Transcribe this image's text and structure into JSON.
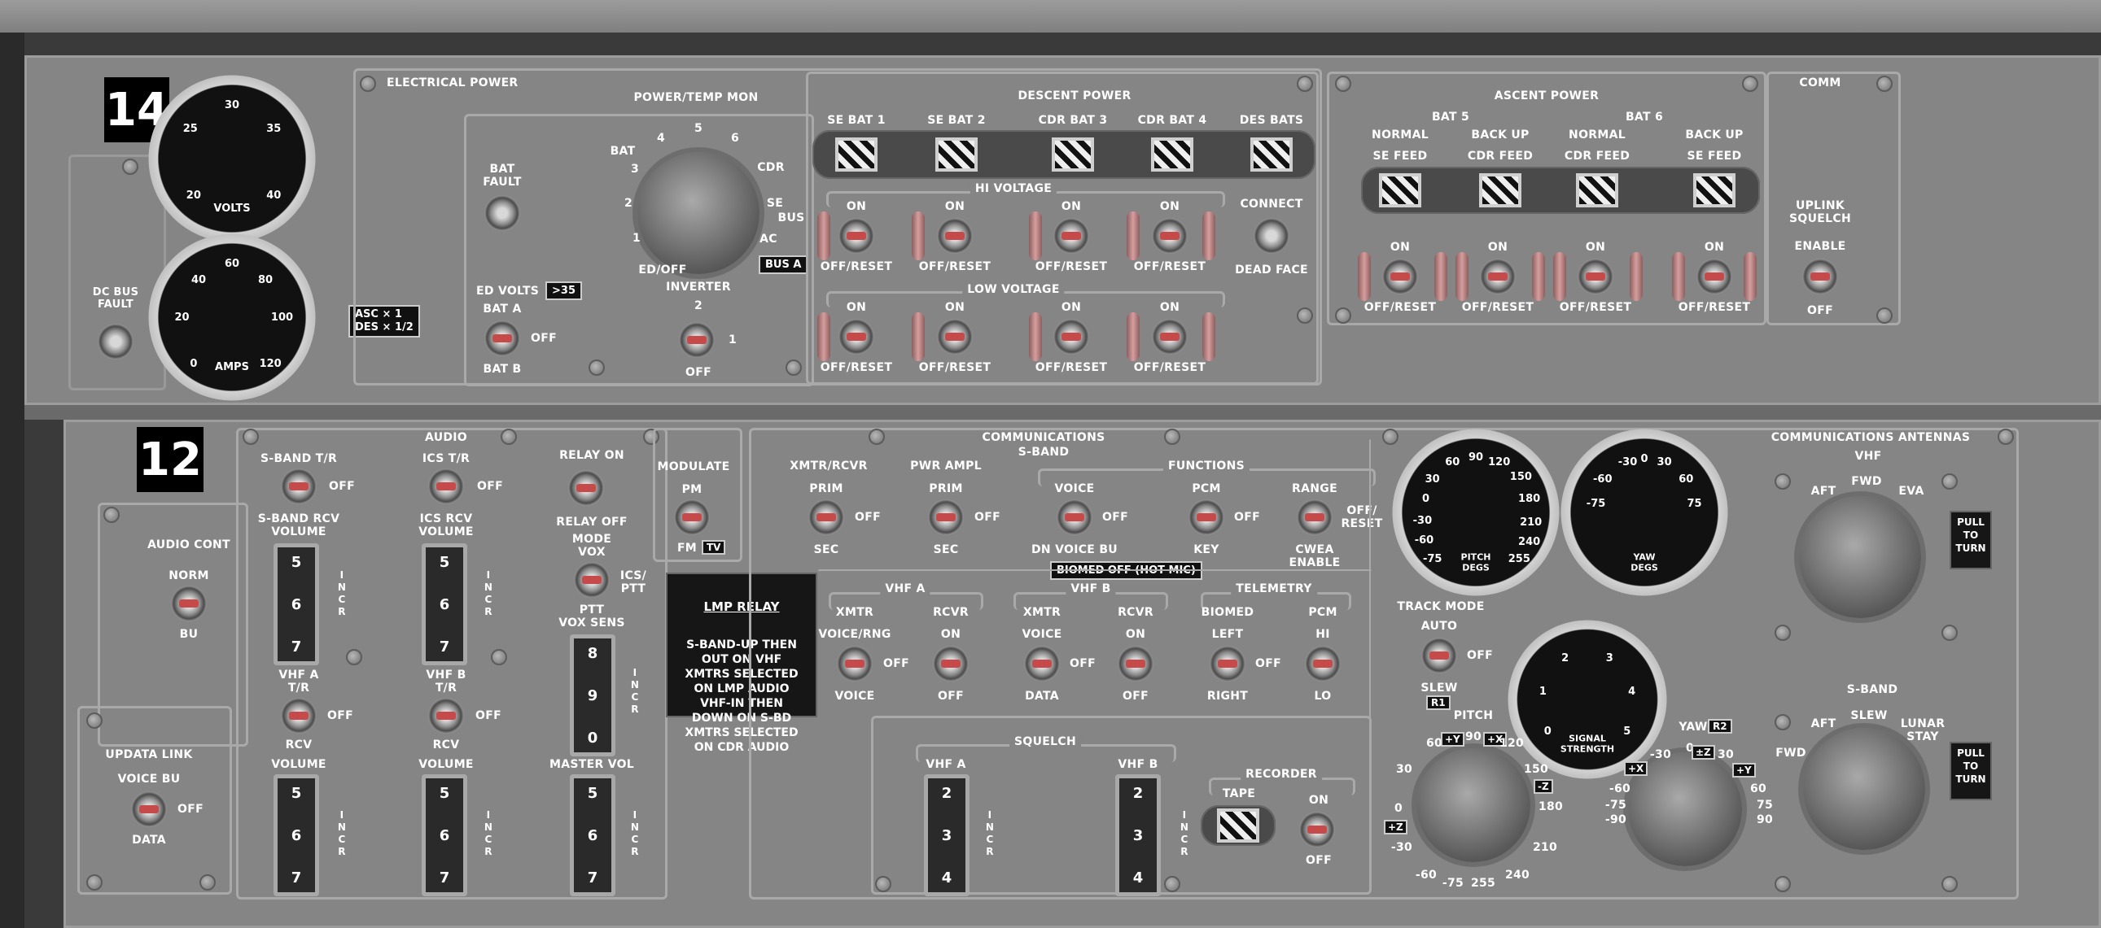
{
  "panel14": {
    "number": "14",
    "electrical_power": "ELECTRICAL POWER",
    "descent_power": "DESCENT POWER",
    "ascent_power": "ASCENT POWER",
    "comm": "COMM",
    "dc_bus_fault": "DC BUS\nFAULT",
    "volts": "VOLTS",
    "amps": "AMPS",
    "volts_ticks": [
      "20",
      "25",
      "30",
      "35",
      "40"
    ],
    "amps_ticks": [
      "0",
      "20",
      "40",
      "60",
      "80",
      "100",
      "120"
    ],
    "asc_des": "ASC × 1\nDES × 1/2",
    "bat_fault": "BAT\nFAULT",
    "power_temp_mon": "POWER/TEMP MON",
    "rotary_positions": [
      "BAT",
      "3",
      "4",
      "5",
      "6",
      "CDR",
      "SE",
      "BUS",
      "AC",
      "2",
      "1",
      "ED/OFF"
    ],
    "bus_a": "BUS A",
    "ed_volts": "ED VOLTS",
    "ed_volts_tag": ">35",
    "bat_a": "BAT A",
    "bat_b": "BAT B",
    "off": "OFF",
    "inverter": "INVERTER",
    "inverter_2": "2",
    "inverter_1": "1",
    "se_bat_1": "SE BAT 1",
    "se_bat_2": "SE BAT 2",
    "cdr_bat_3": "CDR BAT 3",
    "cdr_bat_4": "CDR BAT 4",
    "des_bats": "DES BATS",
    "hi_voltage": "HI VOLTAGE",
    "low_voltage": "LOW VOLTAGE",
    "on": "ON",
    "off_reset": "OFF/RESET",
    "connect": "CONNECT",
    "dead_face": "DEAD FACE",
    "bat5": "BAT 5",
    "bat6": "BAT 6",
    "normal": "NORMAL",
    "back_up": "BACK UP",
    "se_feed": "SE FEED",
    "cdr_feed": "CDR FEED",
    "uplink_squelch": "UPLINK\nSQUELCH",
    "enable": "ENABLE"
  },
  "panel12": {
    "number": "12",
    "audio": "AUDIO",
    "communications": "COMMUNICATIONS",
    "comm_antennas": "COMMUNICATIONS ANTENNAS",
    "s_band": "S-BAND",
    "sband_tr": "S-BAND T/R",
    "ics_tr": "ICS T/R",
    "relay_on": "RELAY ON",
    "relay_off": "RELAY OFF",
    "sband_rcv_volume": "S-BAND RCV\nVOLUME",
    "ics_rcv_volume": "ICS RCV\nVOLUME",
    "mode": "MODE",
    "vox": "VOX",
    "ics_ptt": "ICS/\nPTT",
    "ptt": "PTT",
    "vox_sens": "VOX SENS",
    "incr": "I\nN\nC\nR",
    "thumb_567": [
      "5",
      "6",
      "7"
    ],
    "thumb_890": [
      "8",
      "9",
      "0"
    ],
    "thumb_234": [
      "2",
      "3",
      "4"
    ],
    "audio_cont": "AUDIO CONT",
    "norm": "NORM",
    "bu": "BU",
    "vhf_a_tr": "VHF A\nT/R",
    "vhf_b_tr": "VHF B\nT/R",
    "rcv": "RCV",
    "volume": "VOLUME",
    "master_vol": "MASTER VOL",
    "updata_link": "UPDATA LINK",
    "voice_bu": "VOICE BU",
    "data": "DATA",
    "modulate": "MODULATE",
    "pm": "PM",
    "fm": "FM",
    "tv": "TV",
    "lmp_relay": "LMP RELAY",
    "lmp_relay_text": "S-BAND-UP THEN\nOUT ON VHF\nXMTRS SELECTED\nON LMP AUDIO\nVHF-IN THEN\nDOWN ON S-BD\nXMTRS SELECTED\nON CDR AUDIO",
    "xmtr_rcvr": "XMTR/RCVR",
    "pwr_ampl": "PWR AMPL",
    "prim": "PRIM",
    "sec": "SEC",
    "functions": "FUNCTIONS",
    "voice": "VOICE",
    "dn_voice_bu": "DN VOICE BU",
    "pcm": "PCM",
    "key": "KEY",
    "range": "RANGE",
    "off_reset2": "OFF/\nRESET",
    "cwea_enable": "CWEA\nENABLE",
    "biomed_off": "BIOMED OFF (HOT MIC)",
    "vhf_a": "VHF A",
    "vhf_b": "VHF B",
    "xmtr": "XMTR",
    "rcvr": "RCVR",
    "voice_rng": "VOICE/RNG",
    "telemetry": "TELEMETRY",
    "biomed": "BIOMED",
    "left": "LEFT",
    "right": "RIGHT",
    "hi": "HI",
    "lo": "LO",
    "squelch": "SQUELCH",
    "recorder": "RECORDER",
    "tape": "TAPE",
    "pitch_degs": "PITCH\nDEGS",
    "yaw_degs": "YAW\nDEGS",
    "pitch_ticks": [
      "60",
      "90",
      "120",
      "150",
      "180",
      "210",
      "240",
      "255",
      "30",
      "0",
      "-30",
      "-60",
      "-75"
    ],
    "yaw_ticks": [
      "-30",
      "0",
      "30",
      "60",
      "75",
      "-60",
      "-75"
    ],
    "track_mode": "TRACK MODE",
    "auto": "AUTO",
    "slew": "SLEW",
    "r1": "R1",
    "r2": "R2",
    "signal_strength": "SIGNAL\nSTRENGTH",
    "signal_ticks": [
      "0",
      "1",
      "2",
      "3",
      "4",
      "5"
    ],
    "pitch": "PITCH",
    "yaw": "YAW",
    "pitch_dial": [
      "60",
      "+Y",
      "90",
      "+X",
      "120",
      "150",
      "-Z",
      "180",
      "210",
      "240",
      "255",
      "-75",
      "-60",
      "-30",
      "+Z",
      "0",
      "30"
    ],
    "yaw_dial": [
      "0",
      "-30",
      "30",
      "±Z",
      "+X",
      "+Y",
      "60",
      "75",
      "-60",
      "-75",
      "90",
      "-90"
    ],
    "vhf": "VHF",
    "aft": "AFT",
    "fwd": "FWD",
    "eva": "EVA",
    "pull_to_turn": "PULL\nTO\nTURN",
    "lunar_stay": "LUNAR\nSTAY",
    "sband_ant": "S-BAND"
  }
}
